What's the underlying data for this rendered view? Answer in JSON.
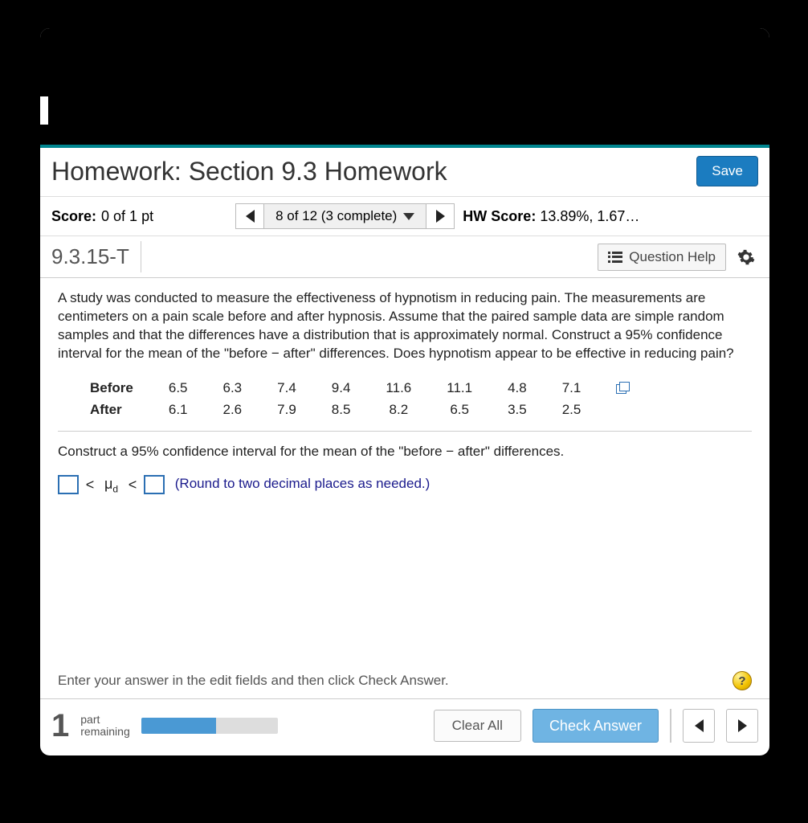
{
  "header": {
    "title": "Homework: Section 9.3 Homework",
    "save_label": "Save"
  },
  "subheader": {
    "score_label": "Score:",
    "score_value": "0 of 1 pt",
    "progress_text": "8 of 12 (3 complete)",
    "hw_label": "HW Score:",
    "hw_value": "13.89%, 1.67…"
  },
  "question": {
    "number": "9.3.15-T",
    "help_label": "Question Help"
  },
  "prompt_text": "A study was conducted to measure the effectiveness of hypnotism in reducing pain. The  measurements are centimeters on a pain scale before and after hypnosis. Assume that the paired sample data are simple random samples and that the differences have a distribution that is approximately normal. Construct a 95% confidence interval for the mean of the \"before − after\" differences. Does hypnotism appear to be effective in reducing pain?",
  "table": {
    "rows": [
      {
        "label": "Before",
        "values": [
          "6.5",
          "6.3",
          "7.4",
          "9.4",
          "11.6",
          "11.1",
          "4.8",
          "7.1"
        ]
      },
      {
        "label": "After",
        "values": [
          "6.1",
          "2.6",
          "7.9",
          "8.5",
          "8.2",
          "6.5",
          "3.5",
          "2.5"
        ]
      }
    ]
  },
  "construct_text": "Construct a 95% confidence interval for the mean of the \"before − after\" differences.",
  "ci": {
    "lt1": "<",
    "mu": "μ",
    "sub": "d",
    "lt2": "<",
    "round_note": "(Round to two decimal places as needed.)"
  },
  "hint_text": "Enter your answer in the edit fields and then click Check Answer.",
  "footer": {
    "big_num": "1",
    "part_line1": "part",
    "part_line2": "remaining",
    "clear_label": "Clear All",
    "check_label": "Check Answer"
  }
}
